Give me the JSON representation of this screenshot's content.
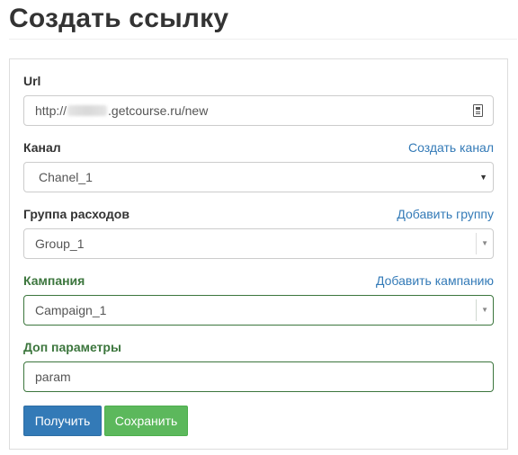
{
  "page": {
    "title": "Создать ссылку"
  },
  "form": {
    "url": {
      "label": "Url",
      "value_prefix": "http://",
      "value_suffix": ".getcourse.ru/new",
      "icon": "clipboard-icon"
    },
    "channel": {
      "label": "Канал",
      "action_link": "Создать канал",
      "selected": "Chanel_1"
    },
    "expense_group": {
      "label": "Группа расходов",
      "action_link": "Добавить группу",
      "selected": "Group_1"
    },
    "campaign": {
      "label": "Кампания",
      "action_link": "Добавить кампанию",
      "selected": "Campaign_1"
    },
    "extra_params": {
      "label": "Доп параметры",
      "value": "param"
    },
    "buttons": {
      "get": "Получить",
      "save": "Сохранить"
    }
  },
  "colors": {
    "primary": "#337ab7",
    "success": "#5cb85c",
    "valid_green": "#3c763d",
    "link": "#337ab7"
  }
}
